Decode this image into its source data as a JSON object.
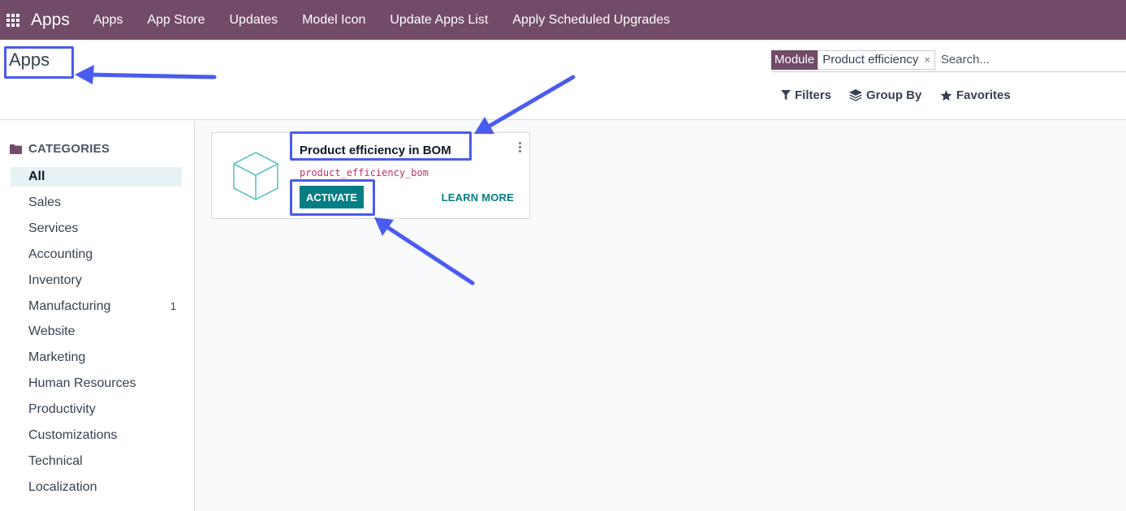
{
  "navbar": {
    "brand": "Apps",
    "menu": [
      {
        "label": "Apps"
      },
      {
        "label": "App Store"
      },
      {
        "label": "Updates"
      },
      {
        "label": "Model Icon"
      },
      {
        "label": "Update Apps List"
      },
      {
        "label": "Apply Scheduled Upgrades"
      }
    ]
  },
  "control_panel": {
    "title": "Apps",
    "search": {
      "facet_label": "Module",
      "facet_value": "Product efficiency",
      "remove_glyph": "×",
      "placeholder": "Search..."
    },
    "filters_label": "Filters",
    "group_by_label": "Group By",
    "favorites_label": "Favorites"
  },
  "sidebar": {
    "header": "CATEGORIES",
    "items": [
      {
        "label": "All",
        "active": true,
        "count": ""
      },
      {
        "label": "Sales",
        "count": ""
      },
      {
        "label": "Services",
        "count": ""
      },
      {
        "label": "Accounting",
        "count": ""
      },
      {
        "label": "Inventory",
        "count": ""
      },
      {
        "label": "Manufacturing",
        "count": "1"
      },
      {
        "label": "Website",
        "count": ""
      },
      {
        "label": "Marketing",
        "count": ""
      },
      {
        "label": "Human Resources",
        "count": ""
      },
      {
        "label": "Productivity",
        "count": ""
      },
      {
        "label": "Customizations",
        "count": ""
      },
      {
        "label": "Technical",
        "count": ""
      },
      {
        "label": "Localization",
        "count": ""
      }
    ]
  },
  "module_card": {
    "title": "Product efficiency in BOM",
    "technical_name": "product_efficiency_bom",
    "activate_label": "ACTIVATE",
    "learn_more_label": "LEARN MORE",
    "icon": "cube-icon"
  },
  "colors": {
    "navbar": "#714b67",
    "primary_button": "#017e84",
    "annotation": "#4a5bf0"
  }
}
